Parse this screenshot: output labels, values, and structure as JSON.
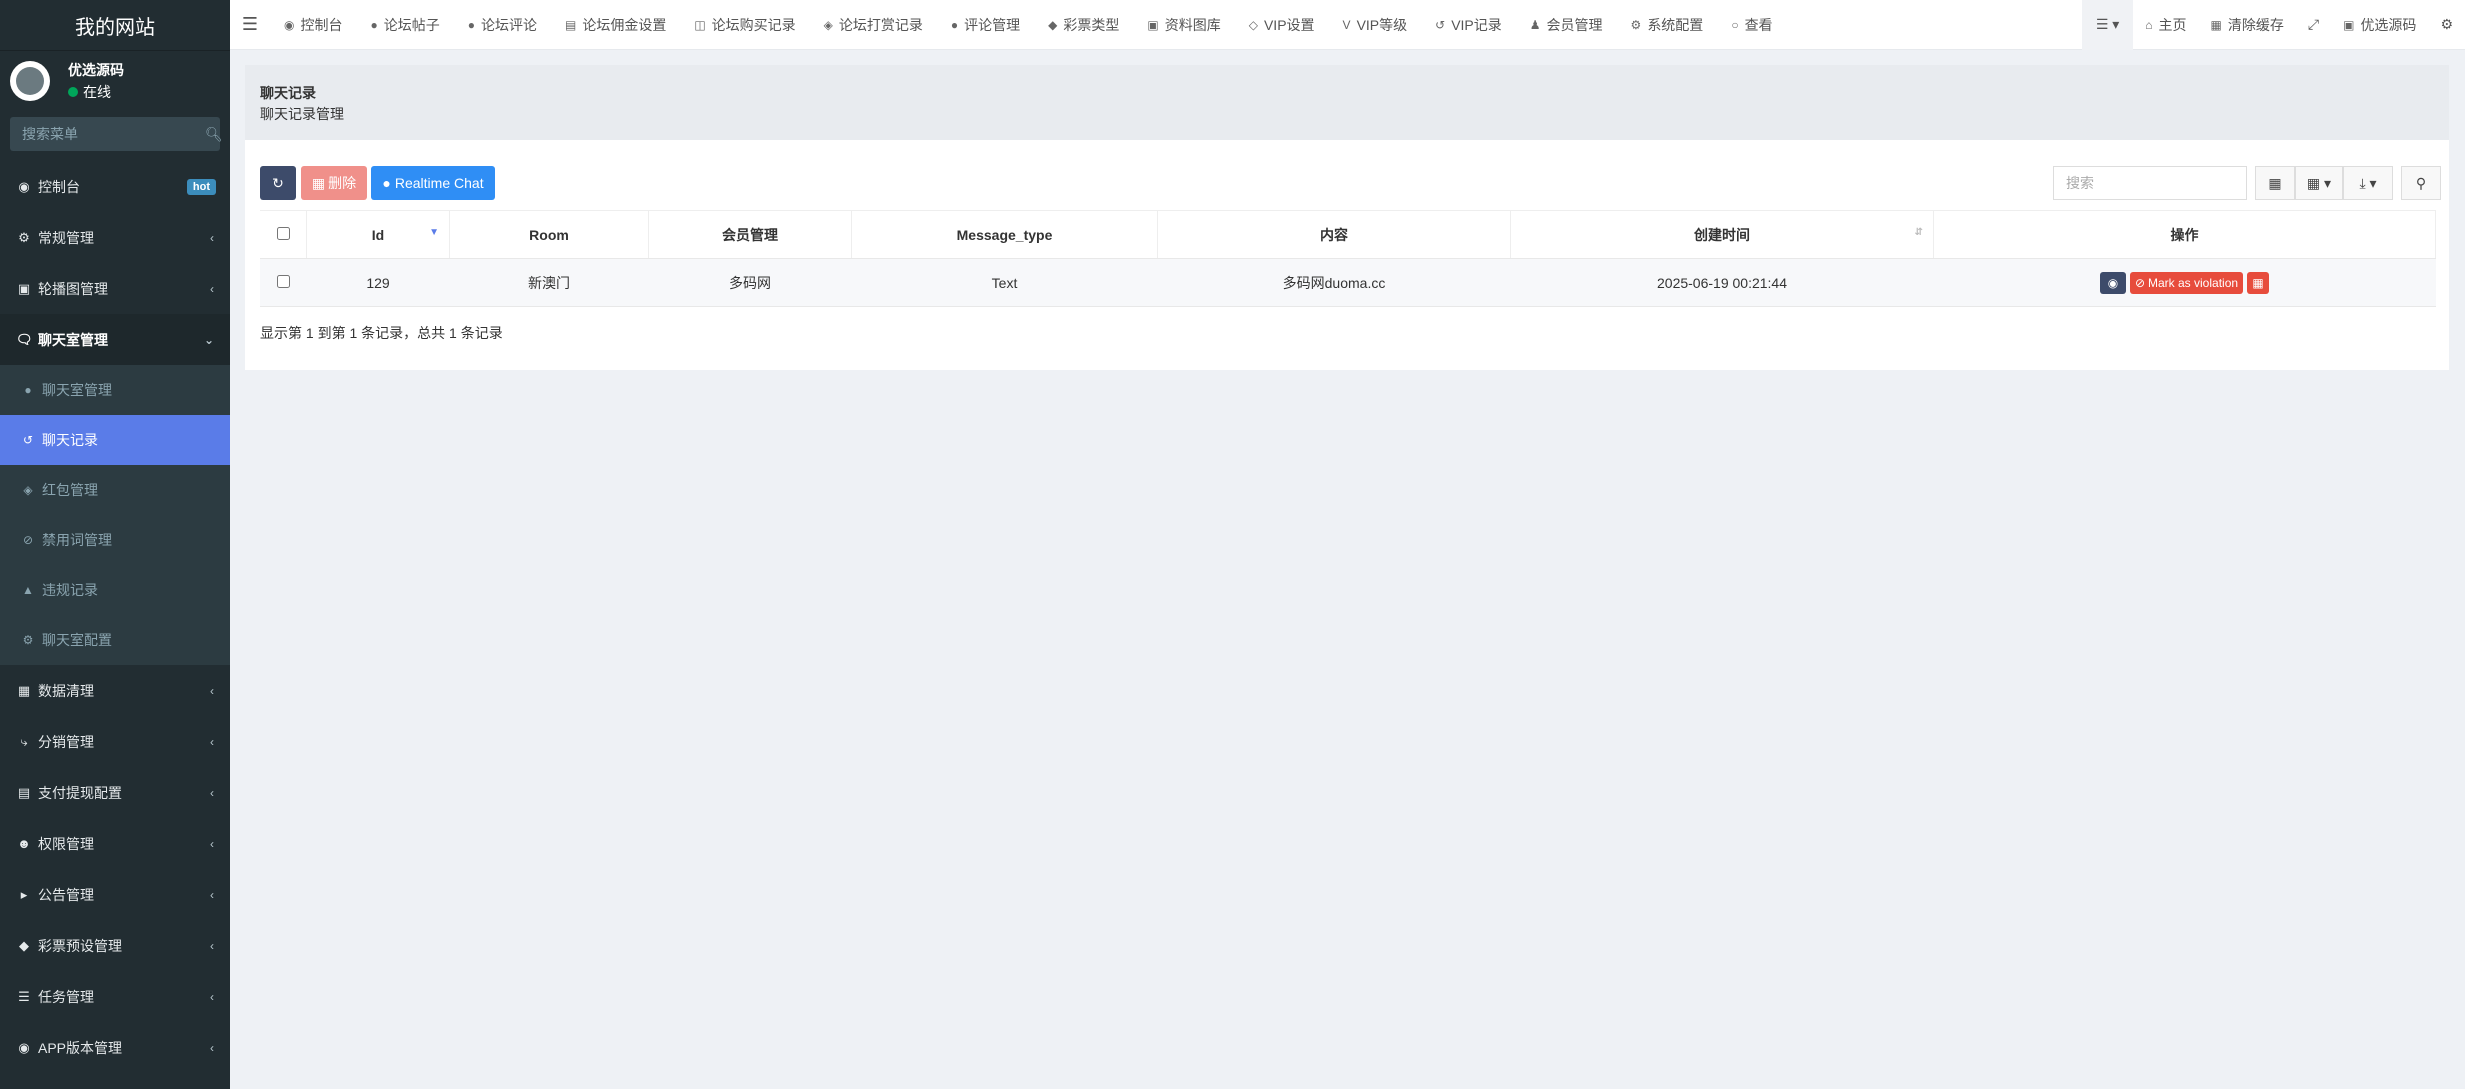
{
  "sidebar": {
    "brand": "我的网站",
    "user_name": "优选源码",
    "status": "在线",
    "search_placeholder": "搜索菜单",
    "hot_badge": "hot",
    "items_top": [
      {
        "label": "控制台",
        "icon": "dashboard-icon"
      },
      {
        "label": "常规管理",
        "icon": "cogs-icon"
      },
      {
        "label": "轮播图管理",
        "icon": "image-icon"
      },
      {
        "label": "聊天室管理",
        "icon": "comments-icon"
      }
    ],
    "subitems": [
      {
        "label": "聊天室管理",
        "icon": "comment-icon"
      },
      {
        "label": "聊天记录",
        "icon": "history-icon"
      },
      {
        "label": "红包管理",
        "icon": "gift-icon"
      },
      {
        "label": "禁用词管理",
        "icon": "ban-icon"
      },
      {
        "label": "违规记录",
        "icon": "warning-icon"
      },
      {
        "label": "聊天室配置",
        "icon": "cogs-icon"
      }
    ],
    "items_bottom": [
      {
        "label": "数据清理",
        "icon": "trash-icon"
      },
      {
        "label": "分销管理",
        "icon": "share-icon"
      },
      {
        "label": "支付提现配置",
        "icon": "money-icon"
      },
      {
        "label": "权限管理",
        "icon": "group-icon"
      },
      {
        "label": "公告管理",
        "icon": "bullhorn-icon"
      },
      {
        "label": "彩票预设管理",
        "icon": "ticket-icon"
      },
      {
        "label": "任务管理",
        "icon": "tasks-icon"
      },
      {
        "label": "APP版本管理",
        "icon": "android-icon"
      }
    ]
  },
  "topnav": {
    "items": [
      {
        "label": "控制台",
        "icon": "dashboard-icon"
      },
      {
        "label": "论坛帖子",
        "icon": "comment-icon"
      },
      {
        "label": "论坛评论",
        "icon": "comments-icon"
      },
      {
        "label": "论坛佣金设置",
        "icon": "money-icon"
      },
      {
        "label": "论坛购买记录",
        "icon": "cart-icon"
      },
      {
        "label": "论坛打赏记录",
        "icon": "gift-icon"
      },
      {
        "label": "评论管理",
        "icon": "comments-icon"
      },
      {
        "label": "彩票类型",
        "icon": "ticket-icon"
      },
      {
        "label": "资料图库",
        "icon": "image-icon"
      },
      {
        "label": "VIP设置",
        "icon": "diamond-icon"
      },
      {
        "label": "VIP等级",
        "icon": "vimeo-icon"
      },
      {
        "label": "VIP记录",
        "icon": "history-icon"
      },
      {
        "label": "会员管理",
        "icon": "user-icon"
      },
      {
        "label": "系统配置",
        "icon": "cog-icon"
      },
      {
        "label": "查看",
        "icon": "circle-icon"
      }
    ],
    "right": {
      "home": "主页",
      "clear_cache": "清除缓存",
      "admin": "优选源码"
    }
  },
  "page": {
    "title": "聊天记录",
    "subtitle": "聊天记录管理",
    "delete_label": "删除",
    "chat_label": "Realtime Chat",
    "search_placeholder": "搜索",
    "columns": [
      "Id",
      "Room",
      "会员管理",
      "Message_type",
      "内容",
      "创建时间",
      "操作"
    ],
    "rows": [
      {
        "id": "129",
        "room": "新澳门",
        "member": "多码网",
        "type": "Text",
        "content": "多码网duoma.cc",
        "created": "2025-06-19 00:21:44"
      }
    ],
    "violation_label": "Mark as violation",
    "footer": "显示第 1 到第 1 条记录，总共 1 条记录"
  },
  "colors": {
    "sidebar_bg": "#222d32",
    "active_item": "#5a7ce8",
    "primary": "#2f8ef5",
    "danger": "#e74c3c"
  }
}
